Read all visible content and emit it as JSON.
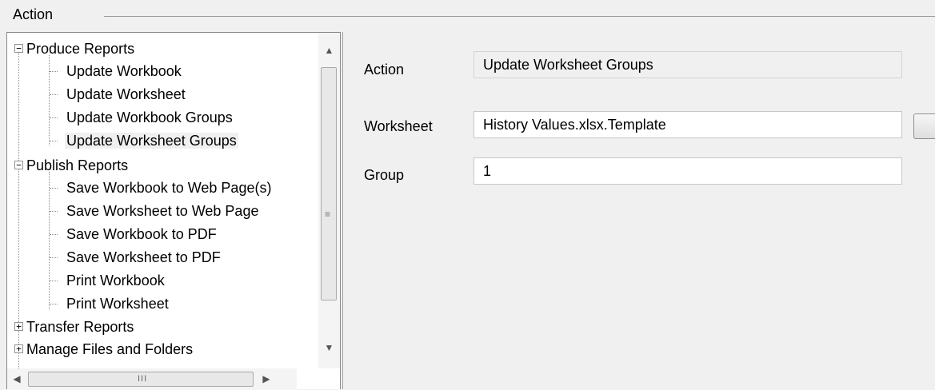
{
  "group": {
    "title": "Action"
  },
  "tree": {
    "items": [
      {
        "label": "Produce Reports"
      },
      {
        "label": "Update Workbook"
      },
      {
        "label": "Update Worksheet"
      },
      {
        "label": "Update Workbook Groups"
      },
      {
        "label": "Update Worksheet Groups"
      },
      {
        "label": "Publish Reports"
      },
      {
        "label": "Save Workbook to Web Page(s)"
      },
      {
        "label": "Save Worksheet to Web Page"
      },
      {
        "label": "Save Workbook to PDF"
      },
      {
        "label": "Save Worksheet to PDF"
      },
      {
        "label": "Print Workbook"
      },
      {
        "label": "Print Worksheet"
      },
      {
        "label": "Transfer Reports"
      },
      {
        "label": "Manage Files and Folders"
      }
    ],
    "expanders": {
      "expanded": "−",
      "collapsed": "+"
    },
    "selected_label": "Update Worksheet Groups"
  },
  "scroll": {
    "up": "▲",
    "down": "▼",
    "left": "◀",
    "right": "▶",
    "vgrip": "≡",
    "hgrip": "III"
  },
  "form": {
    "action": {
      "label": "Action",
      "value": "Update Worksheet Groups"
    },
    "worksheet": {
      "label": "Worksheet",
      "value": "History Values.xlsx.Template"
    },
    "group": {
      "label": "Group",
      "value": "1"
    }
  }
}
